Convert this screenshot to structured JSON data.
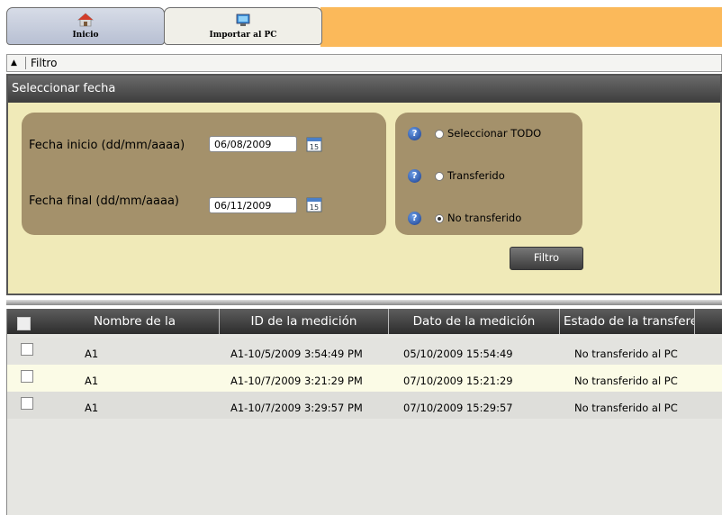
{
  "toolbar": {
    "tabs": [
      {
        "label": "Inicio",
        "active": true,
        "icon": "home-icon"
      },
      {
        "label": "Importar al PC",
        "active": false,
        "icon": "import-pc-icon"
      }
    ],
    "accent": "#fbb95a"
  },
  "filter_toggle": {
    "label": "Filtro",
    "arrow": "▲"
  },
  "date_panel": {
    "title": "Seleccionar fecha",
    "start_label": "Fecha inicio (dd/mm/aaaa)",
    "start_value": "06/08/2009",
    "end_label": "Fecha final (dd/mm/aaaa)",
    "end_value": "06/11/2009",
    "calendar_day": "15",
    "help_symbol": "?",
    "options": [
      {
        "label": "Seleccionar TODO",
        "checked": false
      },
      {
        "label": "Transferido",
        "checked": false
      },
      {
        "label": "No transferido",
        "checked": true
      }
    ],
    "filter_button": "Filtro"
  },
  "table": {
    "columns": [
      "Nombre de la configuración",
      "ID de la medición",
      "Dato de la medición",
      "Estado de la transferer"
    ],
    "rows": [
      {
        "config": "A1",
        "id": "A1-10/5/2009 3:54:49 PM",
        "date": "05/10/2009 15:54:49",
        "status": "No transferido al PC"
      },
      {
        "config": "A1",
        "id": "A1-10/7/2009 3:21:29 PM",
        "date": "07/10/2009 15:21:29",
        "status": "No transferido al PC"
      },
      {
        "config": "A1",
        "id": "A1-10/7/2009 3:29:57 PM",
        "date": "07/10/2009 15:29:57",
        "status": "No transferido al PC"
      }
    ]
  }
}
